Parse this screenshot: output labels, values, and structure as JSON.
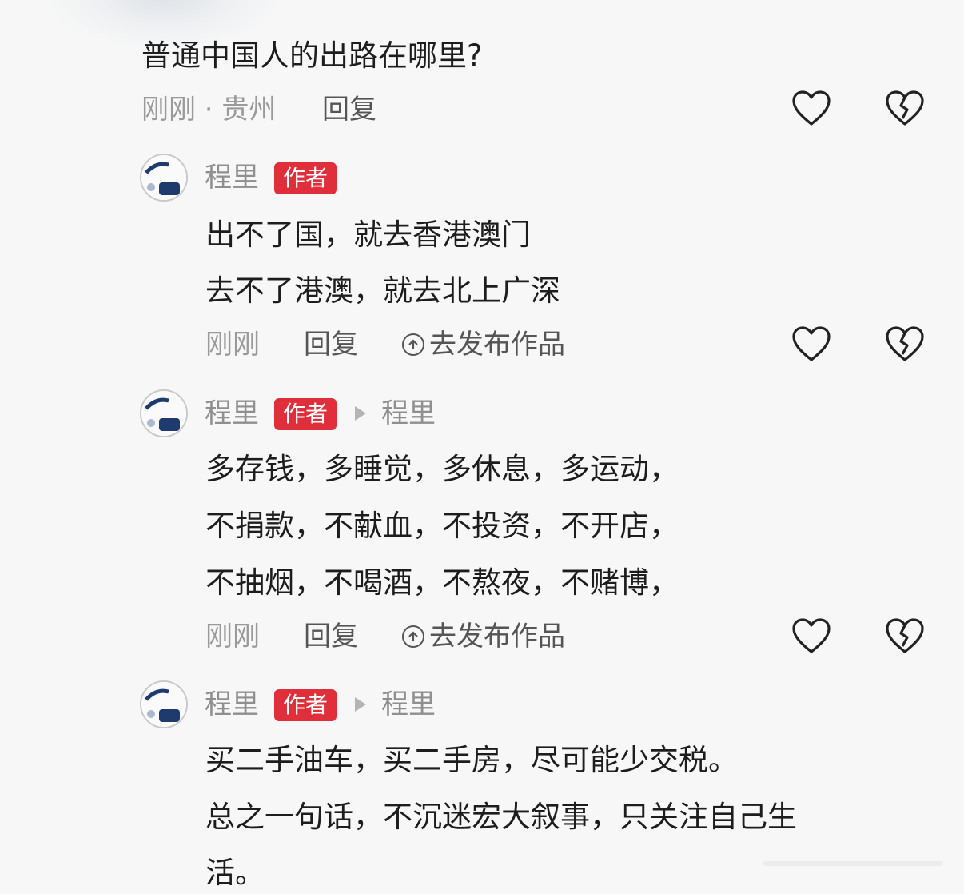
{
  "root_comment": {
    "text": "普通中国人的出路在哪里?",
    "time_location": "刚刚 · 贵州",
    "reply_label": "回复",
    "like_icon": "heart-outline-icon",
    "dislike_icon": "broken-heart-icon"
  },
  "replies": [
    {
      "username": "程里",
      "badge": "作者",
      "reply_to": "",
      "lines": [
        "出不了国，就去香港澳门",
        "去不了港澳，就去北上广深"
      ],
      "time": "刚刚",
      "reply_label": "回复",
      "publish_label": "去发布作品"
    },
    {
      "username": "程里",
      "badge": "作者",
      "reply_to": "程里",
      "lines": [
        "多存钱，多睡觉，多休息，多运动，",
        "不捐款，不献血，不投资，不开店，",
        "不抽烟，不喝酒，不熬夜，不赌博，"
      ],
      "time": "刚刚",
      "reply_label": "回复",
      "publish_label": "去发布作品"
    },
    {
      "username": "程里",
      "badge": "作者",
      "reply_to": "程里",
      "lines": [
        "买二手油车，买二手房，尽可能少交税。",
        "总之一句话，不沉迷宏大叙事，只关注自己生",
        "活。"
      ]
    }
  ],
  "colors": {
    "background": "#f7f7f7",
    "badge": "#e02e3a",
    "text": "#1d1d1d",
    "meta": "#9a9a9a"
  }
}
